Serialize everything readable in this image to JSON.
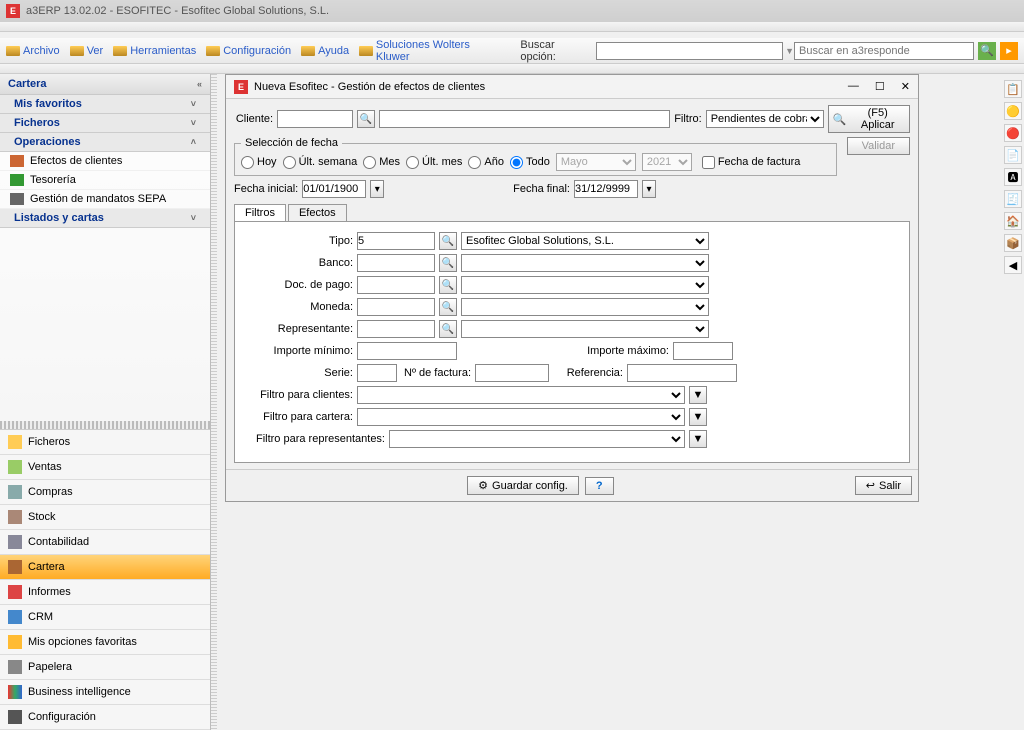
{
  "app": {
    "title": "a3ERP 13.02.02 - ESOFITEC - Esofitec Global Solutions, S.L."
  },
  "menu": {
    "items": [
      "Archivo",
      "Ver",
      "Herramientas",
      "Configuración",
      "Ayuda",
      "Soluciones Wolters Kluwer"
    ],
    "buscar_label": "Buscar opción:",
    "buscar_value": "",
    "a3_placeholder": "Buscar en a3responde"
  },
  "sidebar": {
    "title": "Cartera",
    "sections": {
      "favoritos": "Mis favoritos",
      "ficheros": "Ficheros",
      "operaciones": "Operaciones",
      "listados": "Listados y cartas"
    },
    "ops": [
      "Efectos de clientes",
      "Tesorería",
      "Gestión de mandatos SEPA"
    ]
  },
  "nav": {
    "items": [
      "Ficheros",
      "Ventas",
      "Compras",
      "Stock",
      "Contabilidad",
      "Cartera",
      "Informes",
      "CRM",
      "Mis opciones favoritas",
      "Papelera",
      "Business intelligence",
      "Configuración"
    ]
  },
  "dialog": {
    "title": "Nueva Esofitec - Gestión de efectos de clientes",
    "cliente_label": "Cliente:",
    "filtro_label": "Filtro:",
    "filtro_value": "Pendientes de cobrar;Pen",
    "aplicar": "(F5) Aplicar",
    "validar": "Validar",
    "fecha_legend": "Selección de fecha",
    "radios": {
      "hoy": "Hoy",
      "ult_semana": "Últ. semana",
      "mes": "Mes",
      "ult_mes": "Últ. mes",
      "ano": "Año",
      "todo": "Todo"
    },
    "mes_value": "Mayo",
    "ano_value": "2021",
    "fecha_factura": "Fecha de factura",
    "fi_label": "Fecha inicial:",
    "fi_value": "01/01/1900",
    "ff_label": "Fecha final:",
    "ff_value": "31/12/9999",
    "tabs": {
      "filtros": "Filtros",
      "efectos": "Efectos"
    },
    "fields": {
      "tipo": "Tipo:",
      "tipo_val": "5",
      "tipo_desc": "Esofitec Global Solutions, S.L.",
      "banco": "Banco:",
      "docpago": "Doc. de pago:",
      "moneda": "Moneda:",
      "representante": "Representante:",
      "imp_min": "Importe mínimo:",
      "imp_max": "Importe máximo:",
      "serie": "Serie:",
      "nfact": "Nº de factura:",
      "ref": "Referencia:",
      "f_clientes": "Filtro para clientes:",
      "f_cartera": "Filtro para cartera:",
      "f_repr": "Filtro para representantes:"
    },
    "guardar": "Guardar config.",
    "salir": "Salir"
  }
}
